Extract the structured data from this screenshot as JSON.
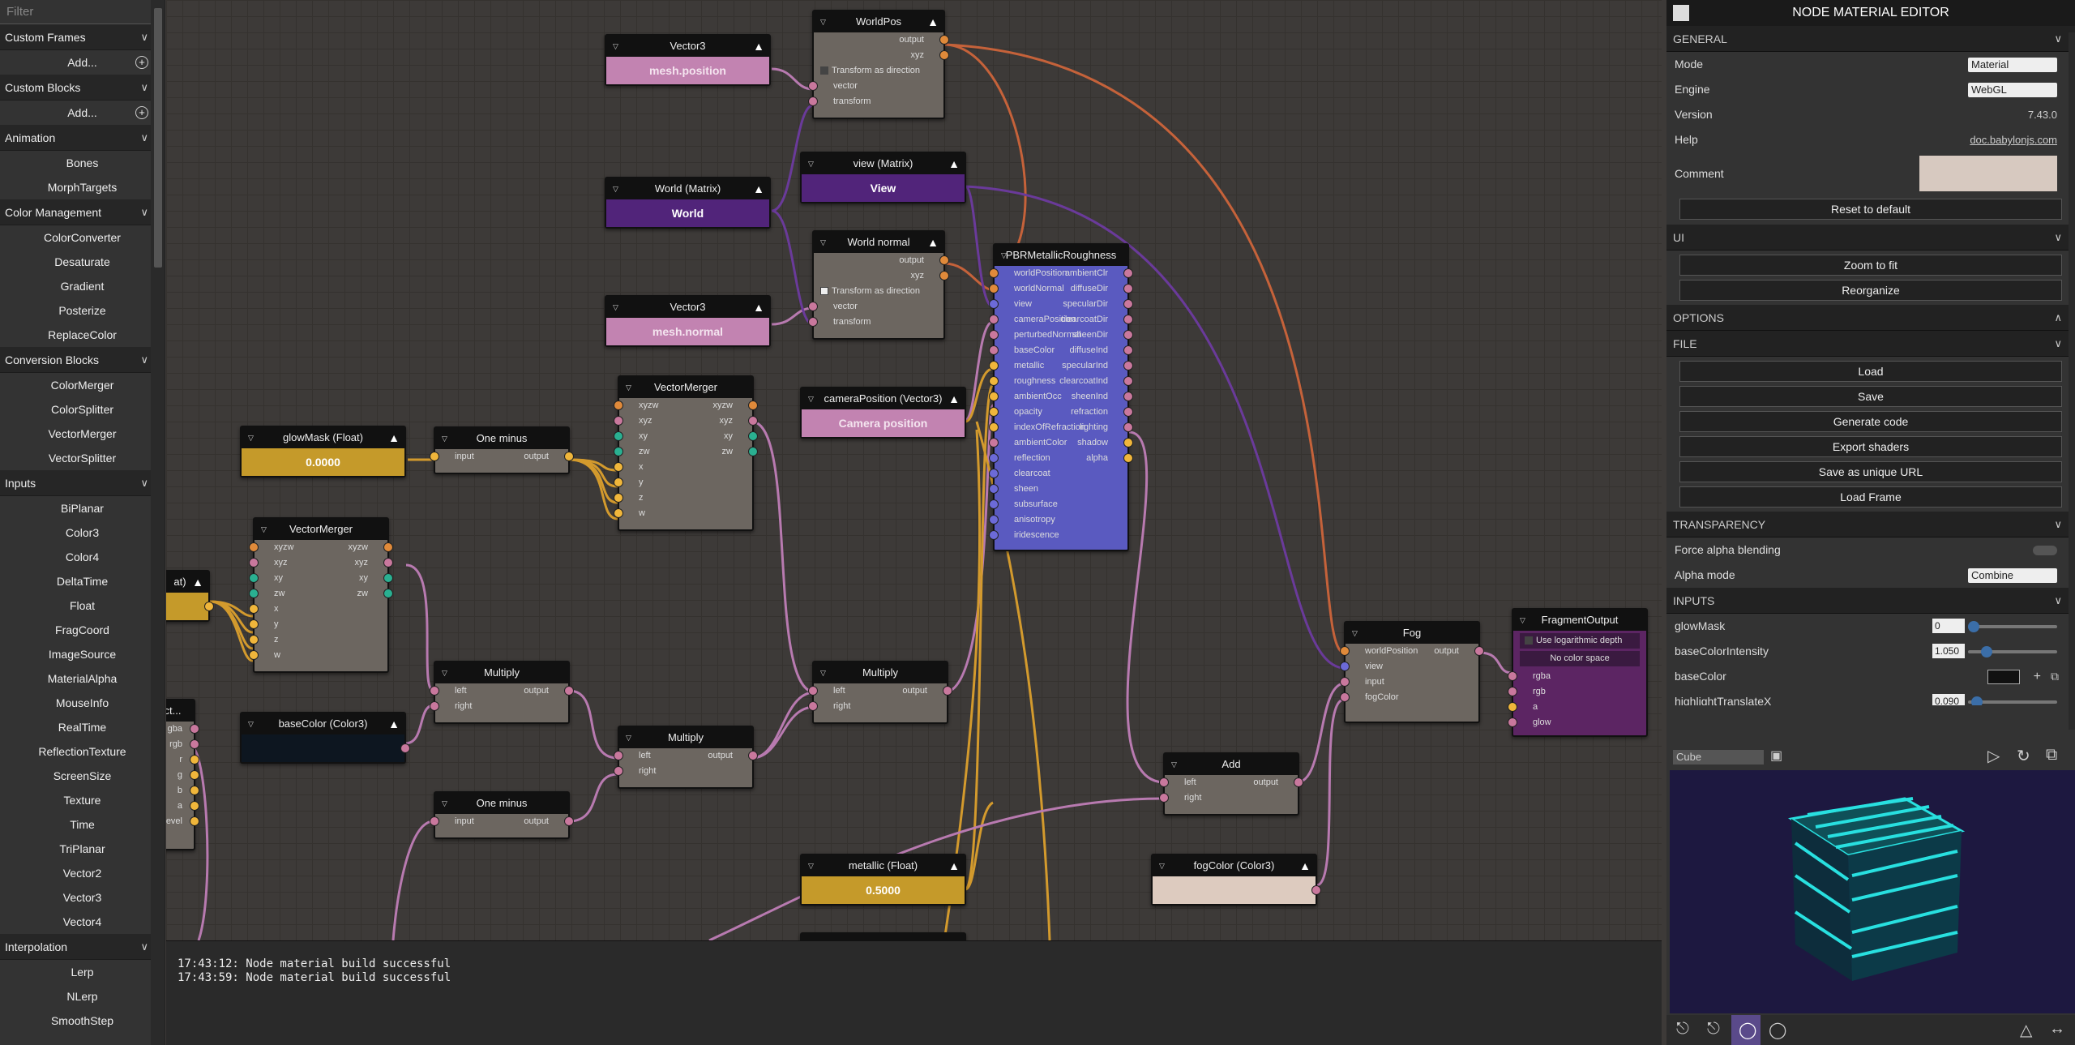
{
  "sidebar": {
    "filter_placeholder": "Filter",
    "categories": [
      {
        "name": "Custom Frames",
        "items": [
          {
            "label": "Add...",
            "plus": true
          }
        ]
      },
      {
        "name": "Custom Blocks",
        "items": [
          {
            "label": "Add...",
            "plus": true
          }
        ]
      },
      {
        "name": "Animation",
        "items": [
          {
            "label": "Bones"
          },
          {
            "label": "MorphTargets"
          }
        ]
      },
      {
        "name": "Color Management",
        "items": [
          {
            "label": "ColorConverter"
          },
          {
            "label": "Desaturate"
          },
          {
            "label": "Gradient"
          },
          {
            "label": "Posterize"
          },
          {
            "label": "ReplaceColor"
          }
        ]
      },
      {
        "name": "Conversion Blocks",
        "items": [
          {
            "label": "ColorMerger"
          },
          {
            "label": "ColorSplitter"
          },
          {
            "label": "VectorMerger"
          },
          {
            "label": "VectorSplitter"
          }
        ]
      },
      {
        "name": "Inputs",
        "items": [
          {
            "label": "BiPlanar"
          },
          {
            "label": "Color3"
          },
          {
            "label": "Color4"
          },
          {
            "label": "DeltaTime"
          },
          {
            "label": "Float"
          },
          {
            "label": "FragCoord"
          },
          {
            "label": "ImageSource"
          },
          {
            "label": "MaterialAlpha"
          },
          {
            "label": "MouseInfo"
          },
          {
            "label": "RealTime"
          },
          {
            "label": "ReflectionTexture"
          },
          {
            "label": "ScreenSize"
          },
          {
            "label": "Texture"
          },
          {
            "label": "Time"
          },
          {
            "label": "TriPlanar"
          },
          {
            "label": "Vector2"
          },
          {
            "label": "Vector3"
          },
          {
            "label": "Vector4"
          }
        ]
      },
      {
        "name": "Interpolation",
        "items": [
          {
            "label": "Lerp"
          },
          {
            "label": "NLerp"
          },
          {
            "label": "SmoothStep"
          }
        ]
      }
    ]
  },
  "nodes": {
    "vec3_pos": {
      "title": "Vector3",
      "value": "mesh.position"
    },
    "worldpos": {
      "title": "WorldPos",
      "out1": "output",
      "out2": "xyz",
      "check": "Transform as direction",
      "in1": "vector",
      "in2": "transform"
    },
    "world_matrix": {
      "title": "World (Matrix)",
      "value": "World"
    },
    "view_matrix": {
      "title": "view (Matrix)",
      "value": "View"
    },
    "world_normal": {
      "title": "World normal",
      "out1": "output",
      "out2": "xyz",
      "check": "Transform as direction",
      "in1": "vector",
      "in2": "transform"
    },
    "vec3_normal": {
      "title": "Vector3",
      "value": "mesh.normal"
    },
    "pbr": {
      "title": "PBRMetallicRoughness",
      "inputs": [
        "worldPosition",
        "worldNormal",
        "view",
        "cameraPosition",
        "perturbedNormal",
        "baseColor",
        "metallic",
        "roughness",
        "ambientOcc",
        "opacity",
        "indexOfRefraction",
        "ambientColor",
        "reflection",
        "clearcoat",
        "sheen",
        "subsurface",
        "anisotropy",
        "iridescence"
      ],
      "outputs": [
        "ambientClr",
        "diffuseDir",
        "specularDir",
        "clearcoatDir",
        "sheenDir",
        "diffuseInd",
        "specularInd",
        "clearcoatInd",
        "sheenInd",
        "refraction",
        "lighting",
        "shadow",
        "alpha"
      ]
    },
    "vecmerger1": {
      "title": "VectorMerger",
      "in": [
        "xyzw",
        "xyz",
        "xy",
        "zw",
        "x",
        "y",
        "z",
        "w"
      ],
      "out": [
        "xyzw",
        "xyz",
        "xy",
        "zw"
      ]
    },
    "vecmerger2": {
      "title": "VectorMerger",
      "in": [
        "xyzw",
        "xyz",
        "xy",
        "zw",
        "x",
        "y",
        "z",
        "w"
      ],
      "out": [
        "xyzw",
        "xyz",
        "xy",
        "zw"
      ]
    },
    "campos": {
      "title": "cameraPosition (Vector3)",
      "value": "Camera position"
    },
    "glowmask": {
      "title": "glowMask (Float)",
      "value": "0.0000"
    },
    "oneminus1": {
      "title": "One minus",
      "in": "input",
      "out": "output"
    },
    "oneminus2": {
      "title": "One minus",
      "in": "input",
      "out": "output"
    },
    "float_partial": {
      "title": "at)"
    },
    "texture_partial": {
      "title": "ct...",
      "ports": [
        "gba",
        "rgb",
        "r",
        "g",
        "b",
        "a",
        "evel"
      ]
    },
    "basecolor": {
      "title": "baseColor (Color3)"
    },
    "multiply1": {
      "title": "Multiply",
      "in1": "left",
      "in2": "right",
      "out": "output"
    },
    "multiply2": {
      "title": "Multiply",
      "in1": "left",
      "in2": "right",
      "out": "output"
    },
    "multiply3": {
      "title": "Multiply",
      "in1": "left",
      "in2": "right",
      "out": "output"
    },
    "add": {
      "title": "Add",
      "in1": "left",
      "in2": "right",
      "out": "output"
    },
    "metallic": {
      "title": "metallic (Float)",
      "value": "0.5000"
    },
    "fogcolor": {
      "title": "fogColor (Color3)"
    },
    "fog": {
      "title": "Fog",
      "in": [
        "worldPosition",
        "view",
        "input",
        "fogColor"
      ],
      "out": "output"
    },
    "fragout": {
      "title": "FragmentOutput",
      "opt1": "Use logarithmic depth",
      "opt2": "No color space",
      "in": [
        "rgba",
        "rgb",
        "a",
        "glow"
      ]
    },
    "bottom_partial": {
      "title": "..."
    }
  },
  "console": {
    "lines": [
      "17:43:12: Node material build successful",
      "17:43:59: Node material build successful"
    ]
  },
  "panel": {
    "title": "NODE MATERIAL EDITOR",
    "general": {
      "header": "GENERAL",
      "mode_label": "Mode",
      "mode_value": "Material",
      "engine_label": "Engine",
      "engine_value": "WebGL",
      "version_label": "Version",
      "version_value": "7.43.0",
      "help_label": "Help",
      "help_value": "doc.babylonjs.com",
      "comment_label": "Comment",
      "reset": "Reset to default"
    },
    "ui": {
      "header": "UI",
      "zoom": "Zoom to fit",
      "reorganize": "Reorganize"
    },
    "options": {
      "header": "OPTIONS"
    },
    "file": {
      "header": "FILE",
      "load": "Load",
      "save": "Save",
      "generate": "Generate code",
      "export": "Export shaders",
      "unique": "Save as unique URL",
      "loadframe": "Load Frame"
    },
    "transparency": {
      "header": "TRANSPARENCY",
      "force": "Force alpha blending",
      "alpha_label": "Alpha mode",
      "alpha_value": "Combine"
    },
    "inputs": {
      "header": "INPUTS",
      "glow_label": "glowMask",
      "glow_value": "0",
      "bci_label": "baseColorIntensity",
      "bci_value": "1.050",
      "bc_label": "baseColor",
      "hl_label": "highlightTranslateX",
      "hl_value": "0.090"
    },
    "preview": {
      "shape": "Cube"
    }
  },
  "colors": {
    "vector3": "#c283b1",
    "matrix": "#51247a",
    "float": "#c59a2a",
    "pbr": "#5a5ac0",
    "fragout": "#5c2563",
    "wire_vec": "#b87ab0",
    "wire_float": "#d39a2d",
    "wire_mat": "#6a3a9a",
    "wire_orange": "#c5623a"
  }
}
